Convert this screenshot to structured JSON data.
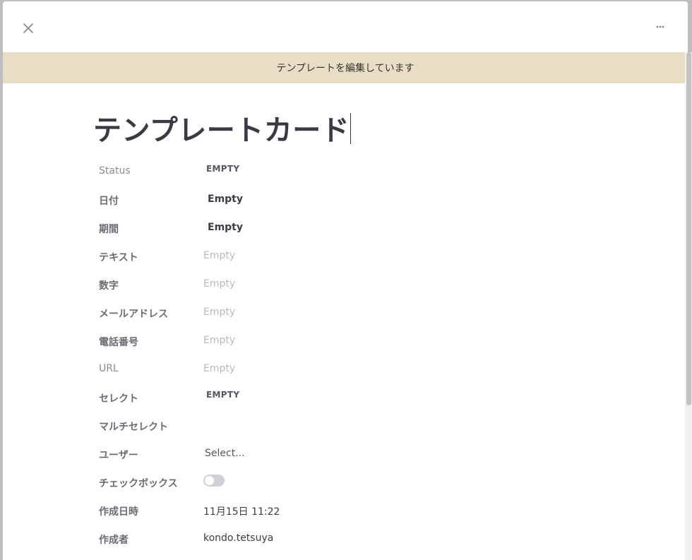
{
  "window": {
    "close_icon": "close-icon",
    "more_icon": "ellipsis-icon"
  },
  "banner": {
    "text": "テンプレートを編集しています"
  },
  "card": {
    "title": "テンプレートカード"
  },
  "properties": [
    {
      "label": "Status",
      "value": "EMPTY"
    },
    {
      "label": "日付",
      "value": "Empty"
    },
    {
      "label": "期間",
      "value": "Empty"
    },
    {
      "label": "テキスト",
      "value": "Empty"
    },
    {
      "label": "数字",
      "value": "Empty"
    },
    {
      "label": "メールアドレス",
      "value": "Empty"
    },
    {
      "label": "電話番号",
      "value": "Empty"
    },
    {
      "label": "URL",
      "value": "Empty"
    },
    {
      "label": "セレクト",
      "value": "EMPTY"
    },
    {
      "label": "マルチセレクト",
      "value": ""
    },
    {
      "label": "ユーザー",
      "value": "Select..."
    },
    {
      "label": "チェックボックス",
      "value": false
    },
    {
      "label": "作成日時",
      "value": "11月15日 11:22"
    },
    {
      "label": "作成者",
      "value": "kondo.tetsuya"
    }
  ],
  "colors": {
    "banner_bg": "#e8ddc5",
    "title": "#3a3a44"
  }
}
